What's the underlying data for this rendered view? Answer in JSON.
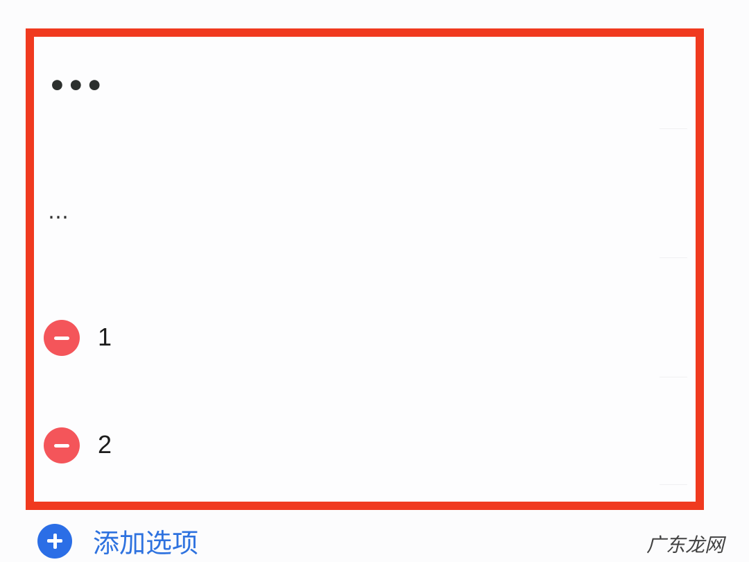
{
  "frame": {
    "border_color": "#f03a1f"
  },
  "header_placeholder": "•••",
  "description_placeholder": "…",
  "options": [
    {
      "label": "1"
    },
    {
      "label": "2"
    }
  ],
  "add_option": {
    "label": "添加选项"
  },
  "watermark": "广东龙网",
  "colors": {
    "remove": "#f4555a",
    "add": "#2b6ee6",
    "add_text": "#2e72df"
  },
  "icons": {
    "remove": "minus-circle-icon",
    "add": "plus-circle-icon"
  }
}
